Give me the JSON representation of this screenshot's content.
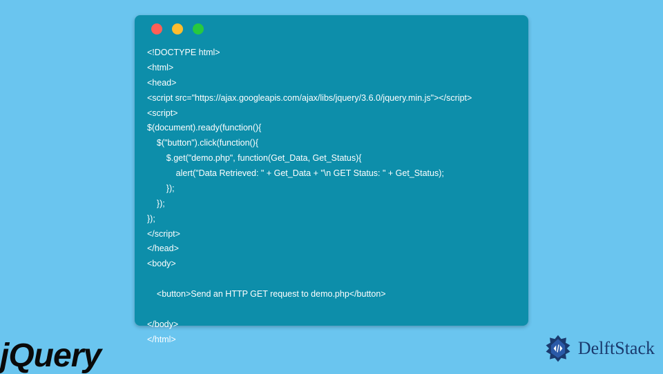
{
  "traffic_lights": {
    "red": "#ff5f56",
    "yellow": "#ffbd2e",
    "green": "#27c93f"
  },
  "code_lines": [
    "<!DOCTYPE html>",
    "<html>",
    "<head>",
    "<script src=\"https://ajax.googleapis.com/ajax/libs/jquery/3.6.0/jquery.min.js\"></script>",
    "<script>",
    "$(document).ready(function(){",
    "    $(\"button\").click(function(){",
    "        $.get(\"demo.php\", function(Get_Data, Get_Status){",
    "            alert(\"Data Retrieved: \" + Get_Data + \"\\n GET Status: \" + Get_Status);",
    "        });",
    "    });",
    "});",
    "</script>",
    "</head>",
    "<body>",
    "",
    "    <button>Send an HTTP GET request to demo.php</button>",
    "",
    "</body>",
    "</html>"
  ],
  "logos": {
    "jquery": "jQuery",
    "delftstack": "DelftStack"
  },
  "colors": {
    "page_bg": "#6ac5ef",
    "window_bg": "#0d8eaa",
    "code_text": "#ffffff",
    "delft_blue": "#1a3a6e"
  }
}
